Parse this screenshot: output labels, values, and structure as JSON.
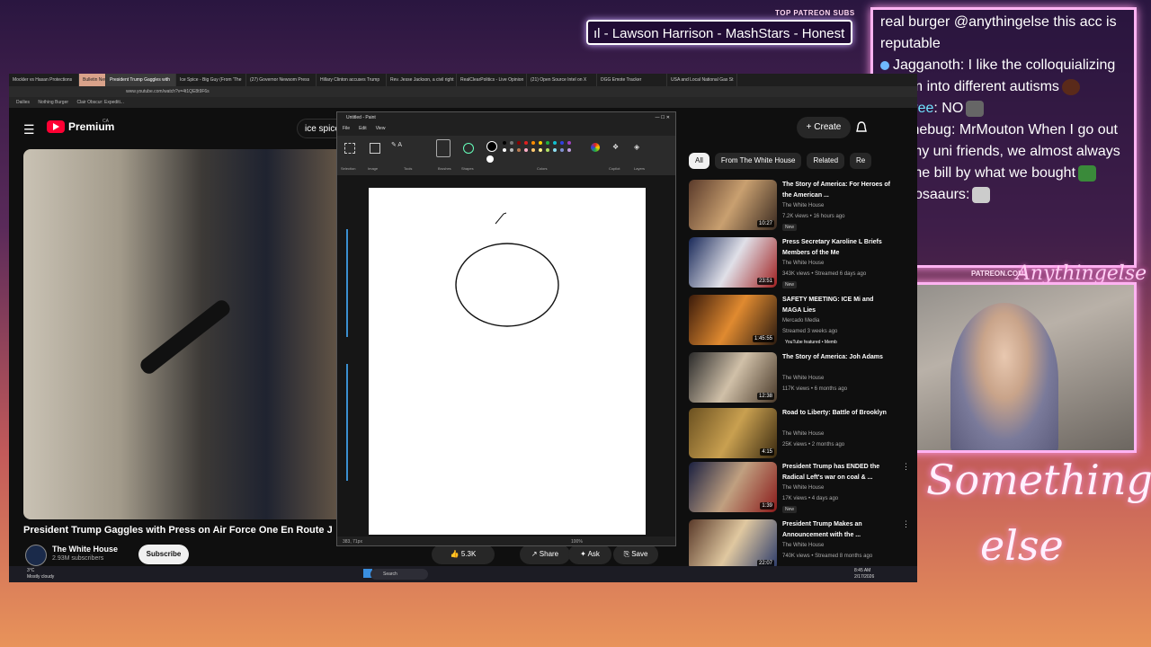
{
  "overlay": {
    "patreon_top_label": "TOP PATREON SUBS",
    "banner_text": "ıl - Lawson Harrison - MashStars - Honest",
    "patreon_mid_label": "PATREON.COM/",
    "logo_line1": "Something",
    "logo_line2": "else",
    "corner_logo": "Anythingelse"
  },
  "chat": [
    {
      "user": "",
      "text": "real burger @anythingelse this acc is reputable"
    },
    {
      "user": "Jagganoth",
      "text": ": I like the colloquializing autism into different autisms"
    },
    {
      "user": "Kbyee",
      "text": ": NO"
    },
    {
      "user": "Dunebug",
      "text": ": MrMouton When I go out with my uni friends, we almost always split the bill by what we bought"
    },
    {
      "user": "Dinosaaurs",
      "text": ":"
    }
  ],
  "browser": {
    "tabs": [
      "Mockler vs Hasan Protections",
      "Bulletin News",
      "President Trump Gaggles with",
      "Ice Spice - Big Guy (From 'The",
      "(27) Governor Newsom Press",
      "Hillary Clinton accuses Trump",
      "Rev. Jesse Jackson, a civil right",
      "RealClearPolitics - Live Opinion",
      "(21) Open Source Intel on X",
      "DGG Emote Tracker",
      "USA and Local National Gas St"
    ],
    "url": "www.youtube.com/watch?v=4t1QE8t9F6s",
    "bookmarks": [
      "Dailies",
      "Nothing Burger",
      "Clair Obscur: Expediti..."
    ]
  },
  "youtube": {
    "brand": "Premium",
    "region": "CA",
    "search_value": "ice spice",
    "create_label": "Create",
    "video_title": "President Trump Gaggles with Press on Air Force One En Route J",
    "channel_name": "The White House",
    "channel_subs": "2.93M subscribers",
    "subscribe_label": "Subscribe",
    "likes": "5.3K",
    "share_label": "Share",
    "ask_label": "Ask",
    "save_label": "Save",
    "chips": [
      "All",
      "From The White House",
      "Related",
      "Re"
    ],
    "recommendations": [
      {
        "title": "The Story of America: For Heroes of the American ...",
        "channel": "The White House",
        "meta": "7.2K views • 16 hours ago",
        "badge": "New",
        "duration": "10:27"
      },
      {
        "title": "Press Secretary Karoline L Briefs Members of the Me",
        "channel": "The White House",
        "meta": "343K views • Streamed 6 days ago",
        "badge": "New",
        "duration": "23:51"
      },
      {
        "title": "SAFETY MEETING: ICE Mi and MAGA Lies",
        "channel": "Mercado Media",
        "meta": "Streamed 3 weeks ago",
        "badge": "YouTube featured • Memb",
        "duration": "1:45:55"
      },
      {
        "title": "The Story of America: Joh Adams",
        "channel": "The White House",
        "meta": "117K views • 6 months ago",
        "badge": "",
        "duration": "12:38"
      },
      {
        "title": "Road to Liberty: Battle of Brooklyn",
        "channel": "The White House",
        "meta": "25K views • 2 months ago",
        "badge": "",
        "duration": "4:15"
      },
      {
        "title": "President Trump has ENDED the Radical Left's war on coal & ...",
        "channel": "The White House",
        "meta": "17K views • 4 days ago",
        "badge": "New",
        "duration": "1:39"
      },
      {
        "title": "President Trump Makes an Announcement with the ...",
        "channel": "The White House",
        "meta": "740K views • Streamed 8 months ago",
        "badge": "",
        "duration": "22:07"
      }
    ]
  },
  "paint": {
    "title": "Untitled - Paint",
    "menu": [
      "File",
      "Edit",
      "View"
    ],
    "groups": [
      "Selection",
      "Image",
      "Tools",
      "Brushes",
      "Shapes",
      "Colors",
      "Copilot",
      "Layers"
    ],
    "status_pos": "383, 71px",
    "zoom": "100%"
  },
  "taskbar": {
    "temp": "3°C",
    "weather": "Mostly cloudy",
    "search_label": "Search",
    "time": "8:45 AM",
    "date": "2/17/2026"
  },
  "colors": {
    "yt_red": "#ff0033",
    "overlay_pink": "#ffb3f2",
    "chat_user_cyan": "#6fe3ff"
  }
}
